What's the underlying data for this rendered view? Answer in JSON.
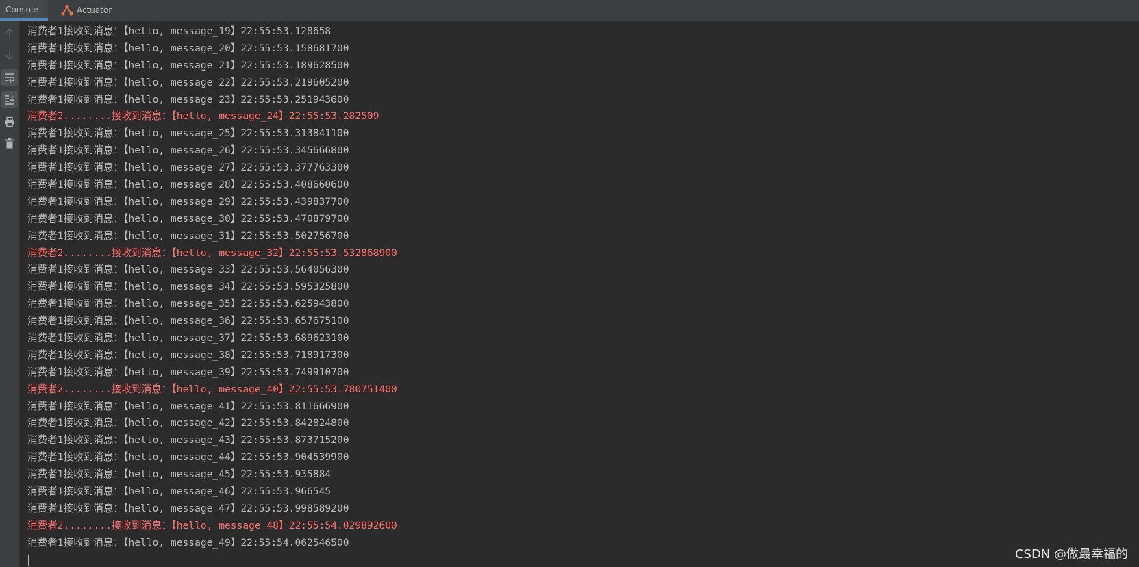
{
  "tabs": {
    "console": "Console",
    "actuator": "Actuator"
  },
  "gutter_icons": [
    "arrow-up-icon",
    "arrow-down-icon",
    "soft-wrap-icon",
    "scroll-to-end-icon",
    "print-icon",
    "clear-all-icon"
  ],
  "colors": {
    "background": "#2b2b2b",
    "chrome": "#3c3f41",
    "normal_text": "#bbbbbb",
    "error_text": "#ff6b68"
  },
  "console_lines": [
    {
      "text": "消费者1接收到消息：【hello, message_19】22:55:53.128658",
      "type": "normal"
    },
    {
      "text": "消费者1接收到消息：【hello, message_20】22:55:53.158681700",
      "type": "normal"
    },
    {
      "text": "消费者1接收到消息：【hello, message_21】22:55:53.189628500",
      "type": "normal"
    },
    {
      "text": "消费者1接收到消息：【hello, message_22】22:55:53.219605200",
      "type": "normal"
    },
    {
      "text": "消费者1接收到消息：【hello, message_23】22:55:53.251943600",
      "type": "normal"
    },
    {
      "text": "消费者2........接收到消息：【hello, message_24】22:55:53.282509",
      "type": "error"
    },
    {
      "text": "消费者1接收到消息：【hello, message_25】22:55:53.313841100",
      "type": "normal"
    },
    {
      "text": "消费者1接收到消息：【hello, message_26】22:55:53.345666800",
      "type": "normal"
    },
    {
      "text": "消费者1接收到消息：【hello, message_27】22:55:53.377763300",
      "type": "normal"
    },
    {
      "text": "消费者1接收到消息：【hello, message_28】22:55:53.408660600",
      "type": "normal"
    },
    {
      "text": "消费者1接收到消息：【hello, message_29】22:55:53.439837700",
      "type": "normal"
    },
    {
      "text": "消费者1接收到消息：【hello, message_30】22:55:53.470879700",
      "type": "normal"
    },
    {
      "text": "消费者1接收到消息：【hello, message_31】22:55:53.502756700",
      "type": "normal"
    },
    {
      "text": "消费者2........接收到消息：【hello, message_32】22:55:53.532868900",
      "type": "error"
    },
    {
      "text": "消费者1接收到消息：【hello, message_33】22:55:53.564056300",
      "type": "normal"
    },
    {
      "text": "消费者1接收到消息：【hello, message_34】22:55:53.595325800",
      "type": "normal"
    },
    {
      "text": "消费者1接收到消息：【hello, message_35】22:55:53.625943800",
      "type": "normal"
    },
    {
      "text": "消费者1接收到消息：【hello, message_36】22:55:53.657675100",
      "type": "normal"
    },
    {
      "text": "消费者1接收到消息：【hello, message_37】22:55:53.689623100",
      "type": "normal"
    },
    {
      "text": "消费者1接收到消息：【hello, message_38】22:55:53.718917300",
      "type": "normal"
    },
    {
      "text": "消费者1接收到消息：【hello, message_39】22:55:53.749910700",
      "type": "normal"
    },
    {
      "text": "消费者2........接收到消息：【hello, message_40】22:55:53.780751400",
      "type": "error"
    },
    {
      "text": "消费者1接收到消息：【hello, message_41】22:55:53.811666900",
      "type": "normal"
    },
    {
      "text": "消费者1接收到消息：【hello, message_42】22:55:53.842824800",
      "type": "normal"
    },
    {
      "text": "消费者1接收到消息：【hello, message_43】22:55:53.873715200",
      "type": "normal"
    },
    {
      "text": "消费者1接收到消息：【hello, message_44】22:55:53.904539900",
      "type": "normal"
    },
    {
      "text": "消费者1接收到消息：【hello, message_45】22:55:53.935884",
      "type": "normal"
    },
    {
      "text": "消费者1接收到消息：【hello, message_46】22:55:53.966545",
      "type": "normal"
    },
    {
      "text": "消费者1接收到消息：【hello, message_47】22:55:53.998589200",
      "type": "normal"
    },
    {
      "text": "消费者2........接收到消息：【hello, message_48】22:55:54.029892600",
      "type": "error"
    },
    {
      "text": "消费者1接收到消息：【hello, message_49】22:55:54.062546500",
      "type": "normal"
    }
  ],
  "watermark": "CSDN @做最幸福的"
}
